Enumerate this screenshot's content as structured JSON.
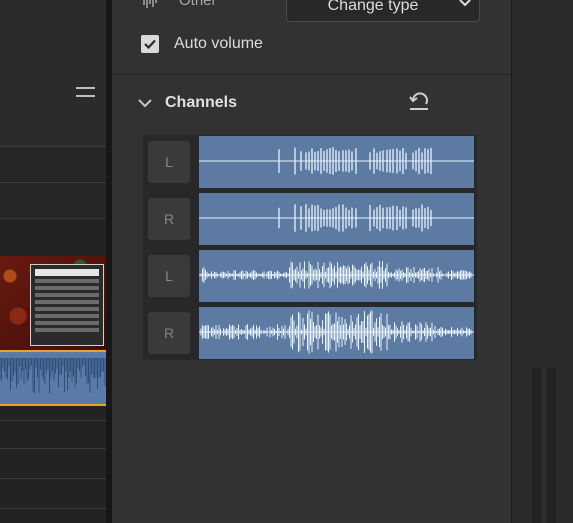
{
  "effect": {
    "type_label": "Other",
    "change_type_button": "Change type",
    "auto_volume": {
      "label": "Auto volume",
      "checked": true
    }
  },
  "channels": {
    "title": "Channels",
    "rows": [
      {
        "label": "L"
      },
      {
        "label": "R"
      },
      {
        "label": "L"
      },
      {
        "label": "R"
      }
    ]
  },
  "colors": {
    "waveform_bg": "#5d7ba2",
    "waveform_line": "#e6f2ff",
    "clip_selection": "#f0a020",
    "panel_bg": "#323232"
  },
  "icons": {
    "hamburger": "hamburger-menu-icon",
    "type": "waveform-icon",
    "dropdown": "chevron-down-icon",
    "check": "checkmark-icon",
    "collapse": "chevron-down-icon",
    "reset": "reset-undo-icon"
  }
}
